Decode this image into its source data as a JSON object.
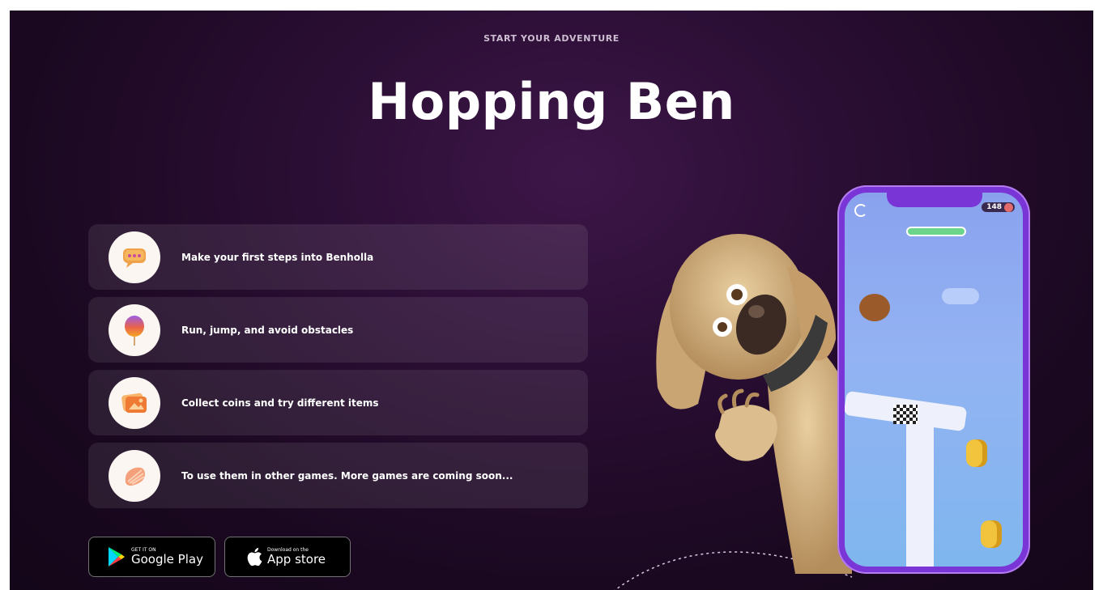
{
  "hero": {
    "eyebrow": "START YOUR ADVENTURE",
    "title": "Hopping Ben"
  },
  "features": [
    {
      "icon": "chat-bubble-icon",
      "text": "Make your first steps into Benholla"
    },
    {
      "icon": "balloon-icon",
      "text": "Run, jump, and avoid obstacles"
    },
    {
      "icon": "photo-card-icon",
      "text": "Collect coins and try different items"
    },
    {
      "icon": "shell-icon",
      "text": "To use them in other games. More games are coming soon..."
    }
  ],
  "stores": {
    "google_play": {
      "small": "GET IT ON",
      "big": "Google Play"
    },
    "app_store": {
      "small": "Download on the",
      "big": "App store"
    }
  },
  "phone_game": {
    "coin_count": "148"
  },
  "colors": {
    "background": "#1a0820",
    "card": "#3a2640",
    "phone_frame": "#7a35d6",
    "sky": "#8aa2ee"
  }
}
